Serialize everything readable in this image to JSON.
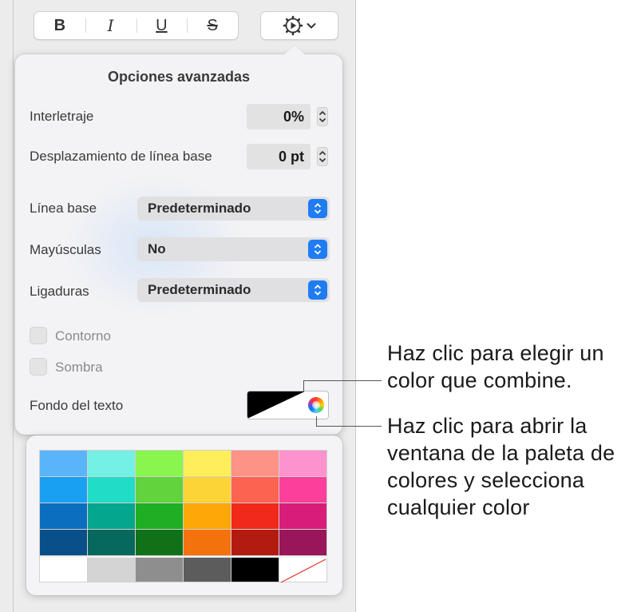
{
  "toolbar": {
    "bold_label": "B",
    "italic_label": "I",
    "underline_label": "U",
    "strikethrough_label": "S",
    "gear_icon": "gear-icon",
    "chevron_icon": "chevron-down-icon"
  },
  "advanced": {
    "title": "Opciones avanzadas",
    "interletraje": {
      "label": "Interletraje",
      "value": "0%"
    },
    "baseline_shift": {
      "label": "Desplazamiento de línea base",
      "value": "0 pt"
    },
    "linea_base": {
      "label": "Línea base",
      "value": "Predeterminado"
    },
    "mayusculas": {
      "label": "Mayúsculas",
      "value": "No"
    },
    "ligaduras": {
      "label": "Ligaduras",
      "value": "Predeterminado"
    },
    "contorno": {
      "label": "Contorno",
      "checked": false
    },
    "sombra": {
      "label": "Sombra",
      "checked": false
    },
    "fondo": {
      "label": "Fondo del texto"
    }
  },
  "palette": {
    "rows": [
      [
        "#5ab4f8",
        "#74f0e4",
        "#8af54e",
        "#fdee5a",
        "#fd9286",
        "#fd93ce"
      ],
      [
        "#1aa0f3",
        "#21dcc6",
        "#62d33c",
        "#fdd435",
        "#fd6351",
        "#fc3f9b"
      ],
      [
        "#0b6ebf",
        "#05a68e",
        "#1fae24",
        "#fda709",
        "#f0291b",
        "#d71d79"
      ],
      [
        "#094f89",
        "#07685d",
        "#117119",
        "#f3720e",
        "#b31a10",
        "#981659"
      ],
      [
        "#ffffff",
        "#d4d4d4",
        "#8e8e8e",
        "#5c5c5c",
        "#000000",
        "none"
      ]
    ],
    "accent": "#1f7cf2"
  },
  "callouts": {
    "match_color": [
      "Haz clic para elegir un",
      "color que combine."
    ],
    "open_palette": [
      "Haz clic para abrir la",
      "ventana de la paleta de",
      "colores y selecciona",
      "cualquier color"
    ]
  }
}
